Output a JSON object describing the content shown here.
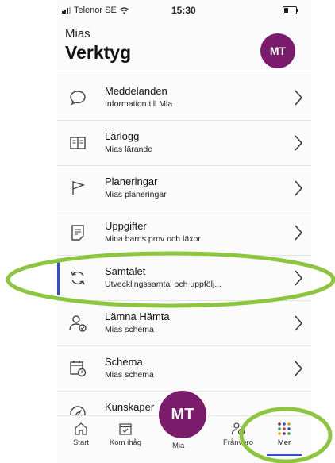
{
  "status_bar": {
    "carrier": "Telenor SE",
    "time": "15:30"
  },
  "header": {
    "subtitle": "Mias",
    "title": "Verktyg",
    "avatar_initials": "MT"
  },
  "menu": [
    {
      "label": "Meddelanden",
      "description": "Information till Mia",
      "icon": "chat-bubble-icon"
    },
    {
      "label": "Lärlogg",
      "description": "Mias lärande",
      "icon": "book-icon"
    },
    {
      "label": "Planeringar",
      "description": "Mias planeringar",
      "icon": "flag-icon"
    },
    {
      "label": "Uppgifter",
      "description": "Mina barns prov och läxor",
      "icon": "checklist-icon"
    },
    {
      "label": "Samtalet",
      "description": "Utvecklingssamtal och uppfölj...",
      "icon": "refresh-icon",
      "active": true
    },
    {
      "label": "Lämna Hämta",
      "description": "Mias schema",
      "icon": "person-check-icon"
    },
    {
      "label": "Schema",
      "description": "Mias schema",
      "icon": "calendar-clock-icon"
    },
    {
      "label": "Kunskaper",
      "description": "",
      "icon": "compass-icon"
    }
  ],
  "tabbar": {
    "start": "Start",
    "kom_ihag": "Kom ihåg",
    "mia": "Mia",
    "franvaro": "Frånvaro",
    "mer": "Mer",
    "center_initials": "MT"
  },
  "colors": {
    "accent_purple": "#7a1b6b",
    "active_blue": "#2b4fd8",
    "highlight_green": "#8cc63f"
  }
}
